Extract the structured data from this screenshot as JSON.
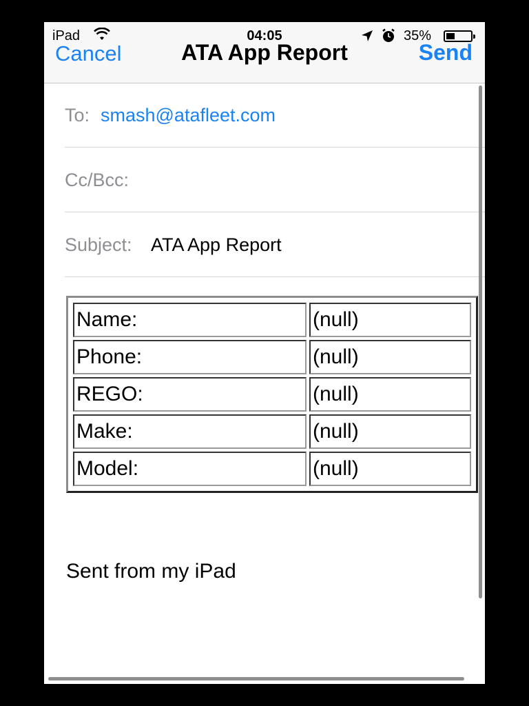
{
  "status_bar": {
    "carrier": "iPad",
    "time": "04:05",
    "battery_percent": "35%",
    "battery_level": 0.35,
    "icons": [
      "wifi-icon",
      "location-arrow-icon",
      "alarm-clock-icon",
      "battery-icon"
    ]
  },
  "nav": {
    "cancel_label": "Cancel",
    "title": "ATA App Report",
    "send_label": "Send"
  },
  "fields": {
    "to_label": "To:",
    "to_value": "smash@atafleet.com",
    "cc_label": "Cc/Bcc:",
    "cc_value": "",
    "subject_label": "Subject:",
    "subject_value": "ATA App Report"
  },
  "report_rows": [
    {
      "label": "Name:",
      "value": "(null)"
    },
    {
      "label": "Phone:",
      "value": "(null)"
    },
    {
      "label": "REGO:",
      "value": "(null)"
    },
    {
      "label": "Make:",
      "value": "(null)"
    },
    {
      "label": "Model:",
      "value": "(null)"
    }
  ],
  "signature": "Sent from my iPad",
  "colors": {
    "accent": "#1a82f2",
    "label_gray": "#8e8e93"
  }
}
